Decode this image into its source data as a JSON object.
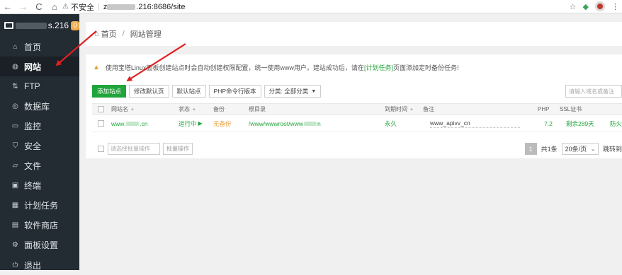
{
  "browser": {
    "back": "←",
    "forward": "→",
    "reload": "C",
    "home": "⌂",
    "security_text": "不安全",
    "url_suffix": ".216:8686/site",
    "url_prefix": "z"
  },
  "sidebar": {
    "server_suffix": "s.216",
    "badge": "0",
    "items": [
      {
        "label": "首页",
        "icon": "home-icon"
      },
      {
        "label": "网站",
        "icon": "globe-icon"
      },
      {
        "label": "FTP",
        "icon": "ftp-icon"
      },
      {
        "label": "数据库",
        "icon": "database-icon"
      },
      {
        "label": "监控",
        "icon": "monitor-icon"
      },
      {
        "label": "安全",
        "icon": "shield-icon"
      },
      {
        "label": "文件",
        "icon": "folder-icon"
      },
      {
        "label": "终端",
        "icon": "terminal-icon"
      },
      {
        "label": "计划任务",
        "icon": "calendar-icon"
      },
      {
        "label": "软件商店",
        "icon": "store-icon"
      },
      {
        "label": "面板设置",
        "icon": "settings-icon"
      },
      {
        "label": "退出",
        "icon": "logout-icon"
      }
    ]
  },
  "breadcrumb": {
    "home": "首页",
    "current": "网站管理"
  },
  "notice": {
    "prefix": "使用宝塔Linux面板创建站点时会自动创建权限配置，统一使用www用户。建站成功后，请在",
    "link": "[计划任务]",
    "suffix": "页面添加定时备份任务!"
  },
  "toolbar": {
    "add_site": "添加站点",
    "modify_default": "修改默认页",
    "default_site": "默认站点",
    "php_cli": "PHP命令行版本",
    "category": "分类: 全部分类"
  },
  "search": {
    "placeholder": "请输入域名或备注"
  },
  "table": {
    "headers": {
      "name": "网站名",
      "status": "状态",
      "backup": "备份",
      "root": "根目录",
      "expire": "到期时间",
      "note": "备注",
      "php": "PHP",
      "ssl": "SSL证书"
    },
    "rows": [
      {
        "name_prefix": "www.",
        "name_suffix": ".cn",
        "status": "运行中",
        "backup": "无备份",
        "root_prefix": "/www/wwwroot/www",
        "root_suffix": "n",
        "expire": "永久",
        "note": "www_apivv_cn",
        "php": "7.2",
        "ssl": "剩余289天",
        "extra": "防火"
      }
    ]
  },
  "footer": {
    "batch_select": "请选择批量操作",
    "batch_btn": "批量操作",
    "page": "1",
    "total": "共1条",
    "per_page": "20条/页",
    "jump": "跳转到"
  },
  "colors": {
    "accent": "#20a53a",
    "sidebar": "#232b33",
    "annotation": "#e02020"
  }
}
